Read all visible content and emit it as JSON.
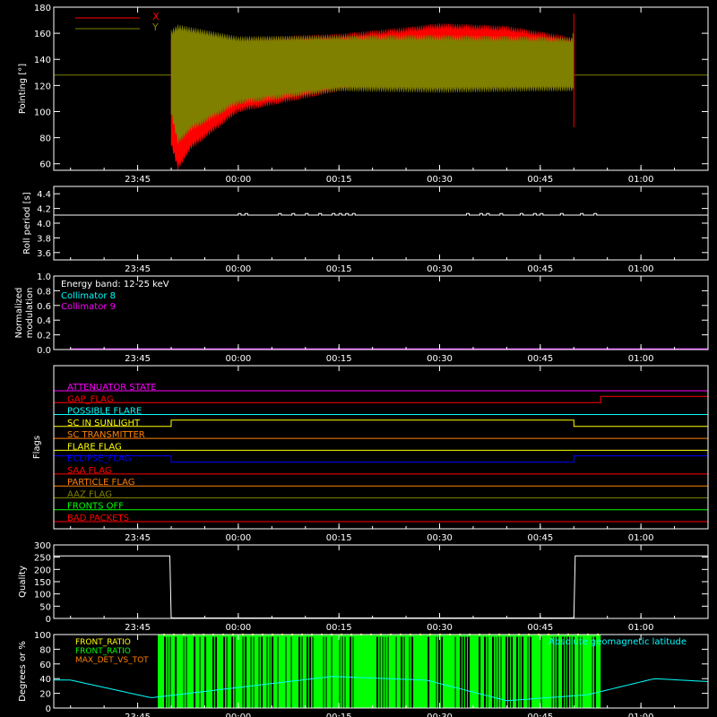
{
  "chart_data": [
    {
      "type": "line",
      "id": "pointing",
      "ylabel": "Pointing [°]",
      "ylim": [
        55,
        180
      ],
      "yticks": [
        60,
        80,
        100,
        120,
        140,
        160,
        180
      ],
      "xticks": [
        "23:45",
        "00:00",
        "00:15",
        "00:30",
        "00:45",
        "01:00"
      ],
      "legend": [
        {
          "name": "X",
          "color": "#ff0000"
        },
        {
          "name": "Y",
          "color": "#808000"
        }
      ],
      "baseline": 128,
      "active_window": {
        "start_min": -10,
        "end_min": 50
      },
      "envelopes": [
        {
          "name": "X",
          "color": "#ff0000",
          "upper": [
            [
              -10,
              152
            ],
            [
              -9,
              154
            ],
            [
              0,
              154
            ],
            [
              15,
              157
            ],
            [
              25,
              162
            ],
            [
              30,
              165
            ],
            [
              40,
              163
            ],
            [
              47,
              157
            ],
            [
              50,
              154
            ]
          ],
          "lower": [
            [
              -10,
              76
            ],
            [
              -9,
              58
            ],
            [
              -7,
              74
            ],
            [
              0,
              102
            ],
            [
              15,
              118
            ],
            [
              30,
              124
            ],
            [
              45,
              130
            ],
            [
              50,
              132
            ]
          ]
        },
        {
          "name": "Y",
          "color": "#808000",
          "upper": [
            [
              -10,
              160
            ],
            [
              -9,
              164
            ],
            [
              0,
              155
            ],
            [
              15,
              156
            ],
            [
              30,
              156
            ],
            [
              45,
              155
            ],
            [
              50,
              154
            ]
          ],
          "lower": [
            [
              -10,
              100
            ],
            [
              -9,
              78
            ],
            [
              -7,
              88
            ],
            [
              0,
              108
            ],
            [
              15,
              118
            ],
            [
              30,
              117
            ],
            [
              45,
              118
            ],
            [
              50,
              118
            ]
          ]
        }
      ]
    },
    {
      "type": "line",
      "id": "roll",
      "ylabel": "Roll period [s]",
      "ylim": [
        3.5,
        4.5
      ],
      "yticks": [
        3.6,
        3.8,
        4.0,
        4.2,
        4.4
      ],
      "yticklabels": [
        "3.6",
        "3.8",
        "4.0",
        "4.2",
        "4.4"
      ],
      "xticks": [
        "23:45",
        "00:00",
        "00:15",
        "00:30",
        "00:45",
        "01:00"
      ],
      "series": [
        {
          "color": "#ffffff",
          "x": [
            -25,
            0,
            0.3,
            1,
            1.3,
            15,
            15.5,
            16,
            16.5,
            50,
            50.3,
            70
          ],
          "y": [
            4.11,
            4.11,
            4.13,
            4.13,
            4.11,
            4.11,
            4.13,
            4.13,
            4.11,
            4.11,
            4.13,
            4.13
          ]
        }
      ]
    },
    {
      "type": "line",
      "id": "modulation",
      "ylabel": "Normalized modulation",
      "ylim": [
        0,
        1
      ],
      "yticks": [
        0,
        0.2,
        0.4,
        0.6,
        0.8,
        1.0
      ],
      "yticklabels": [
        "0.0",
        "0.2",
        "0.4",
        "0.6",
        "0.8",
        "1.0"
      ],
      "xticks": [
        "23:45",
        "00:00",
        "00:15",
        "00:30",
        "00:45",
        "01:00"
      ],
      "annotation": "Energy band: 12-25 keV",
      "series": [
        {
          "name": "Collimator 8",
          "color": "#00ffff",
          "x": [
            -25,
            70
          ],
          "y": [
            0.01,
            0.01
          ]
        },
        {
          "name": "Collimator 9",
          "color": "#ff00ff",
          "x": [
            -25,
            70
          ],
          "y": [
            0.01,
            0.01
          ]
        }
      ]
    },
    {
      "type": "line",
      "id": "flags",
      "ylabel": "Flags",
      "xticks": [
        "23:45",
        "00:00",
        "00:15",
        "00:30",
        "00:45",
        "01:00"
      ],
      "series": [
        {
          "name": "ATTENUATOR STATE",
          "color": "#ff00ff",
          "segments": [
            [
              -25,
              0,
              70
            ]
          ]
        },
        {
          "name": "GAP_FLAG",
          "color": "#ff0000",
          "segments": [
            [
              -25,
              0,
              54
            ],
            [
              54,
              1,
              70
            ]
          ]
        },
        {
          "name": "POSSIBLE FLARE",
          "color": "#00ffff",
          "segments": [
            [
              -25,
              0,
              70
            ]
          ]
        },
        {
          "name": "SC IN SUNLIGHT",
          "color": "#ffff00",
          "segments": [
            [
              -25,
              0,
              -10
            ],
            [
              -10,
              1,
              50
            ],
            [
              50,
              0,
              70
            ]
          ]
        },
        {
          "name": "SC TRANSMITTER",
          "color": "#ff8000",
          "segments": [
            [
              -25,
              0,
              70
            ]
          ]
        },
        {
          "name": "FLARE FLAG",
          "color": "#ffff00",
          "segments": [
            [
              -25,
              0,
              70
            ]
          ]
        },
        {
          "name": "ECLIPSE_FLAG",
          "color": "#0000ff",
          "segments": [
            [
              -25,
              1,
              -10
            ],
            [
              -10,
              0,
              50
            ],
            [
              50,
              1,
              70
            ]
          ]
        },
        {
          "name": "SAA FLAG",
          "color": "#ff0000",
          "segments": [
            [
              -25,
              0,
              70
            ]
          ]
        },
        {
          "name": "PARTICLE FLAG",
          "color": "#ff8000",
          "segments": [
            [
              -25,
              0,
              70
            ]
          ]
        },
        {
          "name": "AAZ FLAG",
          "color": "#808000",
          "segments": [
            [
              -25,
              0,
              70
            ]
          ]
        },
        {
          "name": "FRONTS OFF",
          "color": "#00ff00",
          "segments": [
            [
              -25,
              0,
              70
            ]
          ]
        },
        {
          "name": "BAD PACKETS",
          "color": "#ff0000",
          "segments": [
            [
              -25,
              0,
              70
            ]
          ]
        }
      ]
    },
    {
      "type": "line",
      "id": "quality",
      "ylabel": "Quality",
      "ylim": [
        0,
        300
      ],
      "yticks": [
        0,
        50,
        100,
        150,
        200,
        250,
        300
      ],
      "xticks": [
        "23:45",
        "00:00",
        "00:15",
        "00:30",
        "00:45",
        "01:00"
      ],
      "series": [
        {
          "color": "#ffffff",
          "x": [
            -25,
            -10.2,
            -10,
            50,
            50.2,
            70
          ],
          "y": [
            255,
            255,
            2,
            2,
            255,
            255
          ]
        }
      ]
    },
    {
      "type": "line",
      "id": "fronts",
      "ylabel": "Degrees or %",
      "ylim": [
        0,
        100
      ],
      "yticks": [
        0,
        20,
        40,
        60,
        80,
        100
      ],
      "xticks": [
        "23:45",
        "00:00",
        "00:15",
        "00:30",
        "00:45",
        "01:00"
      ],
      "legend_left": [
        {
          "name": "FRONT_RATIO",
          "color": "#ffff00"
        },
        {
          "name": "FRONT_RATIO",
          "color": "#00ff00"
        },
        {
          "name": "MAX_DET_VS_TOT",
          "color": "#ff8000"
        }
      ],
      "legend_right": "Absolute geomagnetic latitude",
      "front_ratio_window": {
        "start_min": -12,
        "end_min": 54,
        "level": 100
      },
      "latitude": {
        "color": "#00ffff",
        "x": [
          -25,
          -13,
          0,
          14,
          28,
          40,
          52,
          62,
          70
        ],
        "y": [
          38,
          14,
          28,
          43,
          38,
          10,
          18,
          40,
          36
        ]
      }
    }
  ]
}
